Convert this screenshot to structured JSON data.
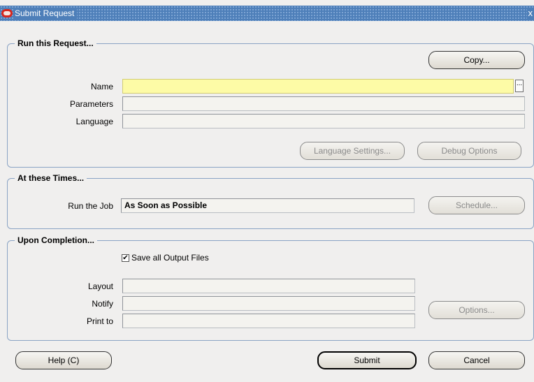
{
  "window": {
    "title": "Submit Request",
    "close_glyph": "x"
  },
  "run_group": {
    "title": "Run this Request...",
    "copy_label": "Copy...",
    "name_label": "Name",
    "name_value": "",
    "lov_glyph": "...",
    "parameters_label": "Parameters",
    "parameters_value": "",
    "language_label": "Language",
    "language_value": "",
    "language_settings_label": "Language Settings...",
    "debug_options_label": "Debug Options"
  },
  "times_group": {
    "title": "At these Times...",
    "run_job_label": "Run the Job",
    "run_job_value": "As Soon as Possible",
    "schedule_label": "Schedule..."
  },
  "completion_group": {
    "title": "Upon Completion...",
    "save_output_label": "Save all Output Files",
    "save_output_checked": true,
    "layout_label": "Layout",
    "layout_value": "",
    "notify_label": "Notify",
    "notify_value": "",
    "print_to_label": "Print to",
    "print_to_value": "",
    "options_label": "Options..."
  },
  "footer": {
    "help_label": "Help (C)",
    "submit_label": "Submit",
    "cancel_label": "Cancel"
  },
  "colors": {
    "titlebar": "#4e7fb9",
    "required_field": "#fdfba6",
    "group_border": "#8aa3c4",
    "background": "#f0efee"
  }
}
